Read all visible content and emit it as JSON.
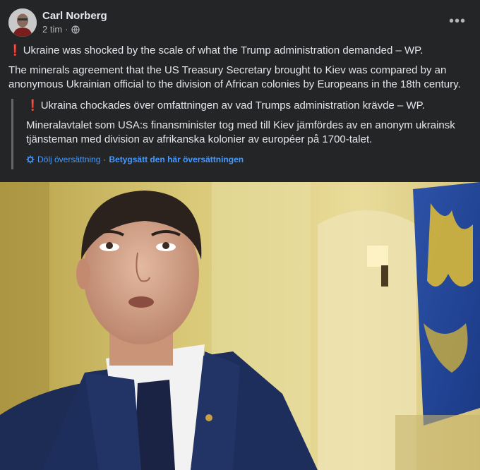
{
  "post": {
    "author": "Carl Norberg",
    "time": "2 tim",
    "separator": "·",
    "more_label": "•••",
    "text_en_1": "Ukraine was shocked by the scale of what the Trump administration demanded – WP.",
    "text_en_2": "The minerals agreement that the US Treasury Secretary brought to Kiev was compared by an anonymous Ukrainian official to the division of African colonies by Europeans in the 18th century.",
    "exclamation": "❗",
    "text_sv_1": "Ukraina chockades över omfattningen av vad Trumps administration krävde – WP.",
    "text_sv_2": "Mineralavtalet som USA:s finansminister tog med till Kiev jämfördes av en anonym ukrainsk tjänsteman med division av afrikanska kolonier av européer på 1700-talet.",
    "hide_translation": "Dölj översättning",
    "rate_translation": "Betygsätt den här översättningen"
  },
  "colors": {
    "link": "#4599ff",
    "exclamation": "#e41e3f",
    "card": "#242526"
  },
  "icons": [
    "globe-icon",
    "gear-icon",
    "more-icon"
  ]
}
